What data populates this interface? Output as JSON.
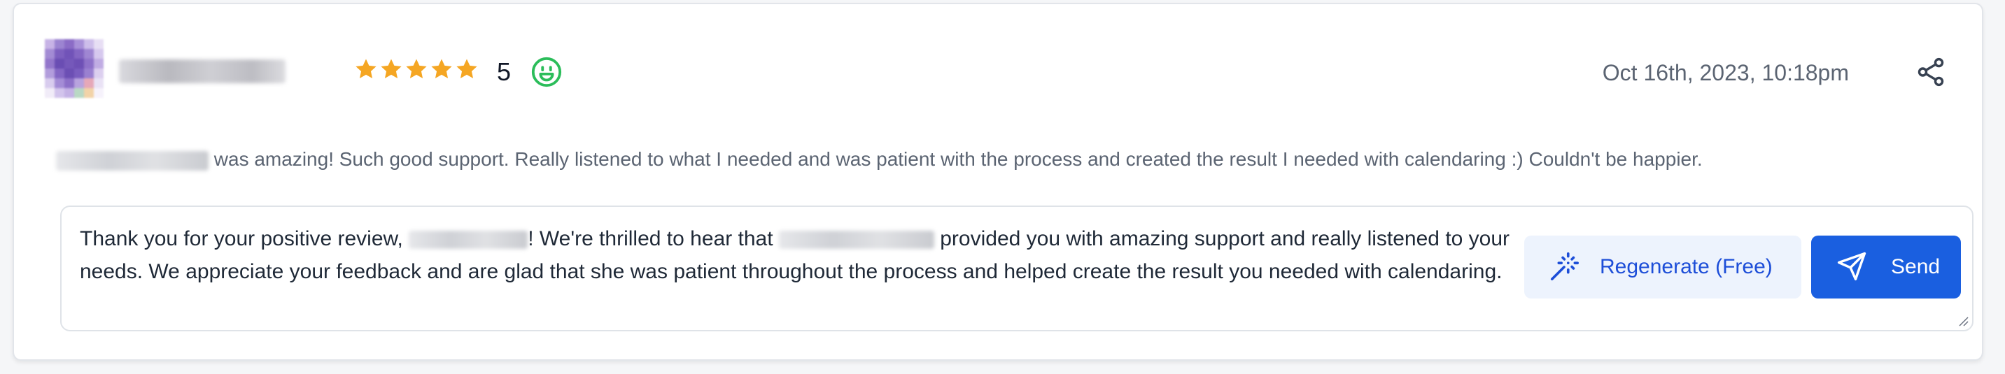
{
  "review": {
    "rating_value": "5",
    "rating_stars": 5,
    "date": "Oct 16th, 2023, 10:18pm",
    "text": "was amazing! Such good support. Really listened to what I needed and was patient with the process and created the result I needed with calendaring :) Couldn't be happier."
  },
  "reply": {
    "part1": "Thank you for your positive review, ",
    "part2": "! We're thrilled to hear that ",
    "part3": " provided you with amazing support and really listened to your needs. We appreciate your feedback and are glad that she was patient throughout the process and helped create the result you needed with calendaring."
  },
  "actions": {
    "regenerate_label": "Regenerate (Free)",
    "send_label": "Send"
  },
  "icons": {
    "star": "star-icon",
    "sentiment": "smile-icon",
    "share": "share-icon",
    "regenerate": "magic-wand-icon",
    "send": "send-icon"
  },
  "colors": {
    "star": "#f5a623",
    "smile": "#2bbd5a",
    "primary": "#1a5fe0",
    "secondary_bg": "#edf3fd",
    "secondary_text": "#1d4ed8",
    "muted_text": "#5b6472"
  }
}
